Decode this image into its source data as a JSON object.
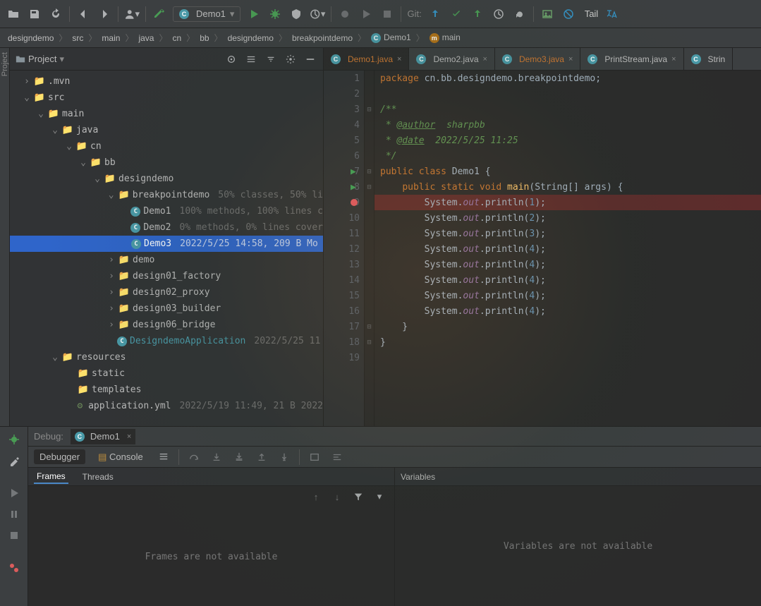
{
  "toolbar": {
    "run_config_label": "Demo1",
    "git_label": "Git:",
    "tail_label": "Tail"
  },
  "breadcrumb": [
    "designdemo",
    "src",
    "main",
    "java",
    "cn",
    "bb",
    "designdemo",
    "breakpointdemo"
  ],
  "breadcrumb_class": "Demo1",
  "breadcrumb_method": "main",
  "project_panel": {
    "title": "Project"
  },
  "tree": {
    "mvn": ".mvn",
    "src": "src",
    "main": "main",
    "java": "java",
    "cn": "cn",
    "bb": "bb",
    "designdemo": "designdemo",
    "breakpointdemo": "breakpointdemo",
    "breakpointdemo_meta": "50% classes, 50% li",
    "demo1": "Demo1",
    "demo1_meta": "100% methods, 100% lines c",
    "demo2": "Demo2",
    "demo2_meta": "0% methods, 0% lines cover",
    "demo3": "Demo3",
    "demo3_meta": "2022/5/25 14:58, 209 B Mo",
    "demo": "demo",
    "design01": "design01_factory",
    "design02": "design02_proxy",
    "design03": "design03_builder",
    "design06": "design06_bridge",
    "app_class": "DesigndemoApplication",
    "app_class_meta": "2022/5/25 11",
    "resources": "resources",
    "static": "static",
    "templates": "templates",
    "app_yml": "application.yml",
    "app_yml_meta": "2022/5/19 11:49, 21 B 2022"
  },
  "tabs": [
    {
      "label": "Demo1.java",
      "active": true
    },
    {
      "label": "Demo2.java",
      "active": false
    },
    {
      "label": "Demo3.java",
      "active": false
    },
    {
      "label": "PrintStream.java",
      "active": false
    },
    {
      "label": "Strin",
      "active": false
    }
  ],
  "code": {
    "package_kw": "package",
    "package_name": "cn.bb.designdemo.breakpointdemo",
    "doc_start": "/**",
    "author_tag": "@author",
    "author_val": "sharpbb",
    "date_tag": "@date",
    "date_val": "2022/5/25 11:25",
    "doc_end": " */",
    "public": "public",
    "class_kw": "class",
    "class_name": "Demo1",
    "static_kw": "static",
    "void_kw": "void",
    "main_fn": "main",
    "string_type": "String[]",
    "args": "args",
    "sys": "System",
    "out": "out",
    "println": "println",
    "vals": [
      "1",
      "2",
      "3",
      "4",
      "4",
      "4",
      "4",
      "4"
    ]
  },
  "debug": {
    "label": "Debug:",
    "tab_name": "Demo1",
    "debugger_tab": "Debugger",
    "console_tab": "Console",
    "frames_tab": "Frames",
    "threads_tab": "Threads",
    "variables_label": "Variables",
    "frames_msg": "Frames are not available",
    "vars_msg": "Variables are not available"
  }
}
